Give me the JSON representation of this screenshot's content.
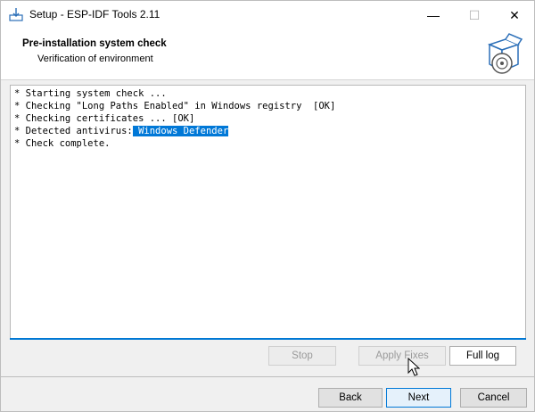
{
  "window": {
    "title": "Setup - ESP-IDF Tools 2.11",
    "min_glyph": "—",
    "max_glyph": "☐",
    "close_glyph": "✕"
  },
  "header": {
    "title": "Pre-installation system check",
    "subtitle": "Verification of environment"
  },
  "log": {
    "lines": [
      "* Starting system check ...",
      "* Checking \"Long Paths Enabled\" in Windows registry  [OK]",
      "* Checking certificates ... [OK]",
      "* Detected antivirus:",
      "* Check complete."
    ],
    "antivirus_highlight": " Windows Defender"
  },
  "actions": {
    "stop": "Stop",
    "apply_fixes": "Apply Fixes",
    "full_log": "Full log"
  },
  "nav": {
    "back": "Back",
    "next": "Next",
    "cancel": "Cancel"
  },
  "colors": {
    "accent": "#0078d7",
    "selection": "#0078d7"
  }
}
